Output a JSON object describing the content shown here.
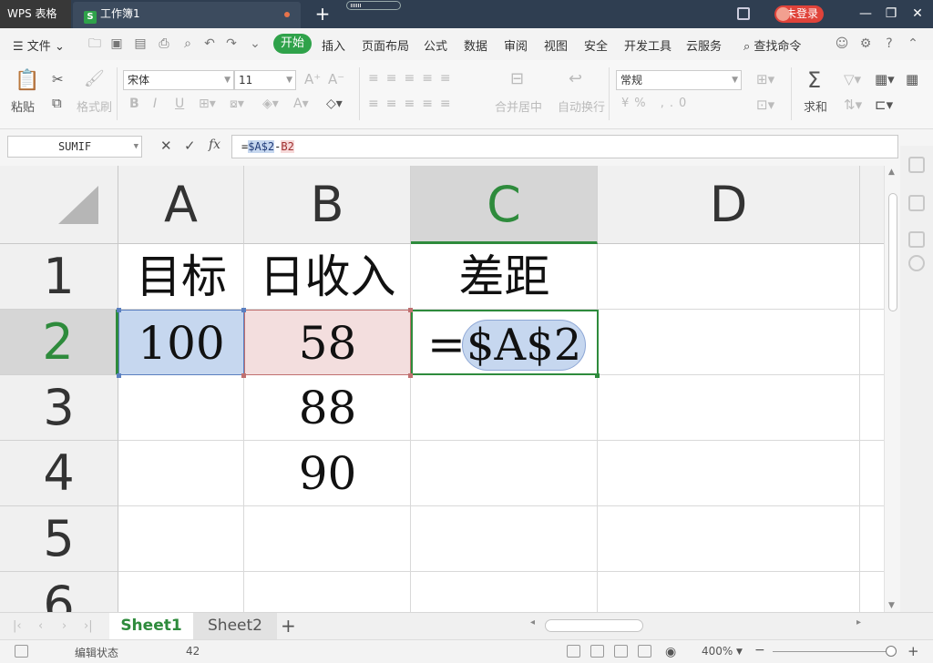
{
  "titlebar": {
    "app_name": "WPS 表格",
    "doc_tab": "工作簿1",
    "login": "未登录"
  },
  "menubar": {
    "file": "文件",
    "start": "开始",
    "items": [
      "插入",
      "页面布局",
      "公式",
      "数据",
      "审阅",
      "视图",
      "安全",
      "开发工具",
      "云服务"
    ],
    "search": "查找命令"
  },
  "ribbon": {
    "paste": "粘贴",
    "format_painter": "格式刷",
    "font_name": "宋体",
    "font_size": "11",
    "merge_center": "合并居中",
    "wrap_text": "自动换行",
    "number_format": "常规",
    "sum": "求和"
  },
  "formula_bar": {
    "name_box": "SUMIF",
    "fx": "fx",
    "formula_prefix": "=",
    "formula_ref_a": "$A$2",
    "formula_op": "-",
    "formula_ref_b": "B2"
  },
  "grid": {
    "columns": [
      "A",
      "B",
      "C",
      "D"
    ],
    "rows": [
      "1",
      "2",
      "3",
      "4",
      "5",
      "6"
    ],
    "selected_column": "C",
    "selected_row": "2",
    "cells": {
      "A1": "目标",
      "B1": "日收入",
      "C1": "差距",
      "A2": "100",
      "B2": "58",
      "C2_eq": "=",
      "C2_ref": "$A$2",
      "B3": "88",
      "B4": "90"
    },
    "highlight_colors": {
      "a2": "#c6d7ef",
      "b2": "#f3dede",
      "active": "#2e8b3c"
    }
  },
  "sheets": [
    "Sheet1",
    "Sheet2"
  ],
  "active_sheet": "Sheet1",
  "statusbar": {
    "mode": "编辑状态",
    "value": "42",
    "zoom": "400%"
  }
}
